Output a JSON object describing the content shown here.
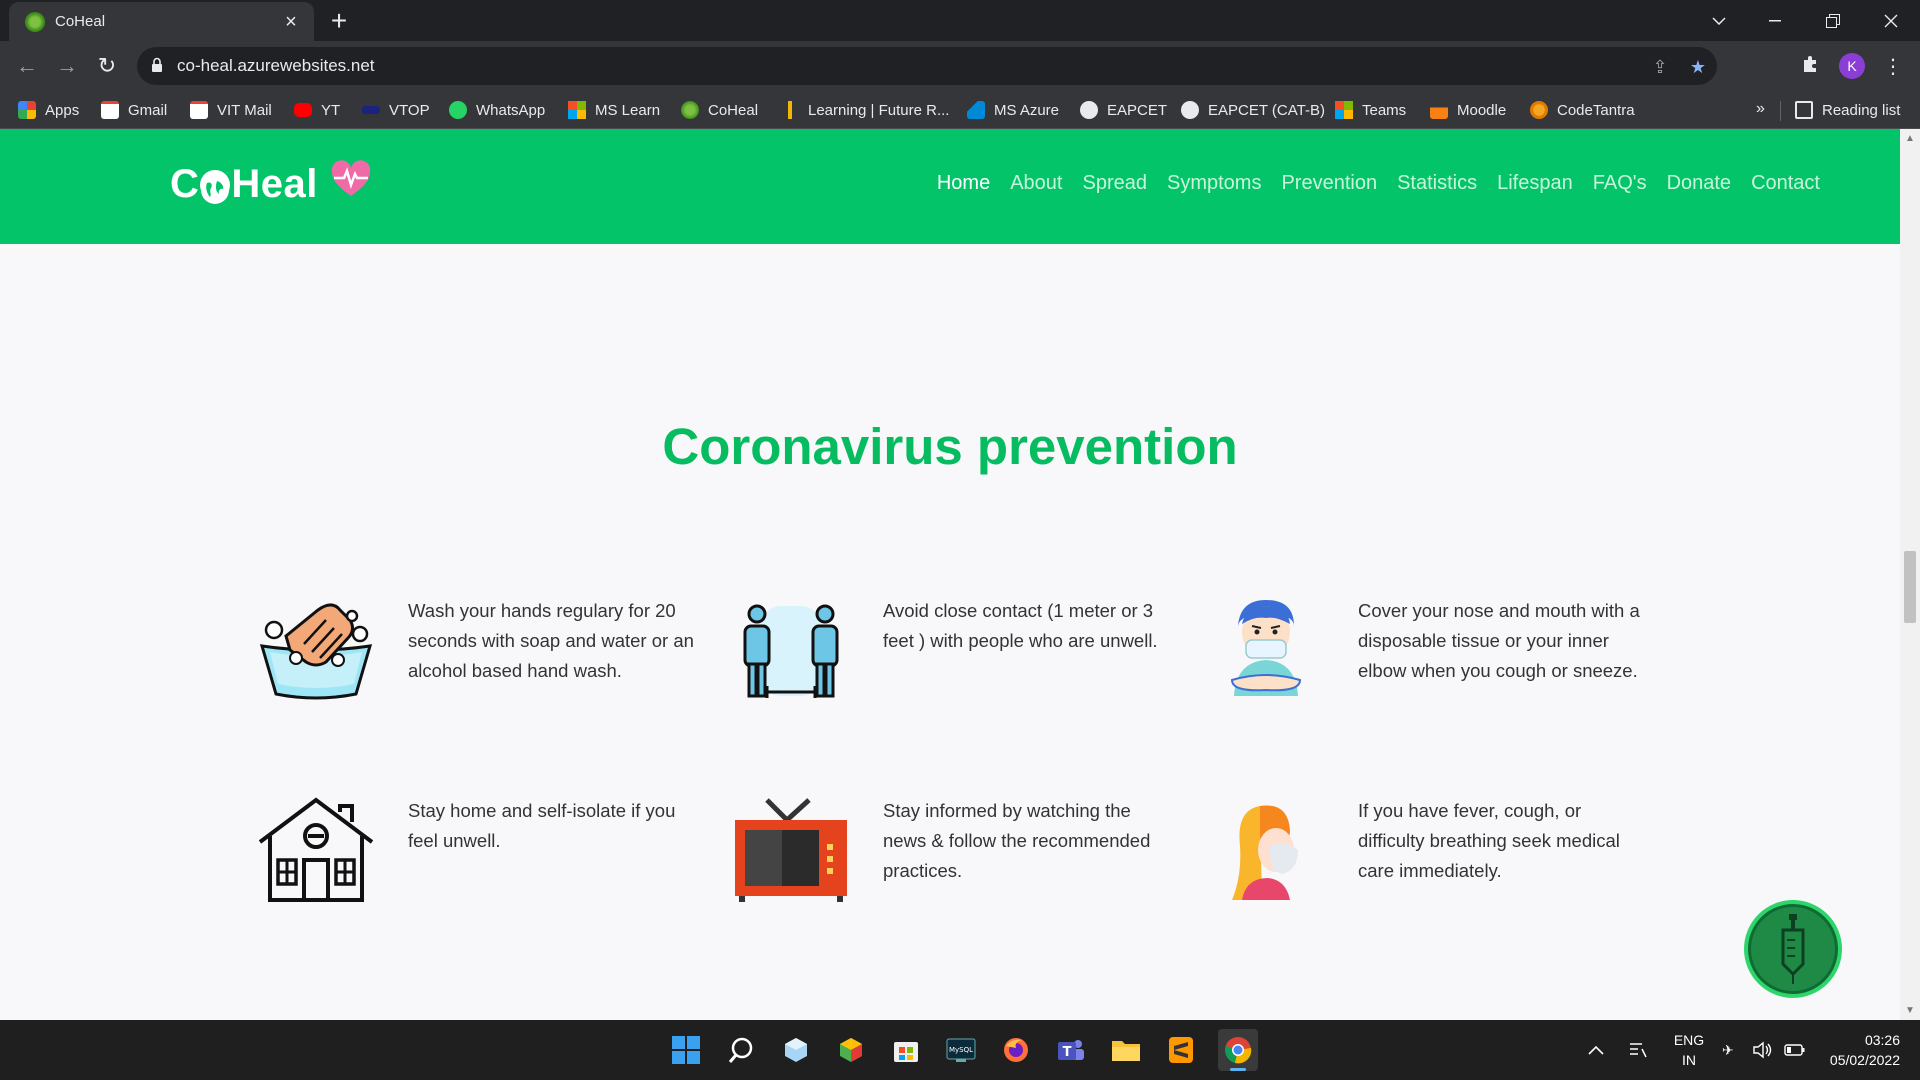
{
  "browser": {
    "tab_title": "CoHeal",
    "url": "co-heal.azurewebsites.net",
    "profile_initial": "K",
    "bookmarks": [
      {
        "label": "Apps",
        "icon": "apps-grid-icon",
        "color": "#4285f4"
      },
      {
        "label": "Gmail",
        "icon": "gmail-icon",
        "color": "#ea4335"
      },
      {
        "label": "VIT Mail",
        "icon": "gmail-icon",
        "color": "#ea4335"
      },
      {
        "label": "YT",
        "icon": "youtube-icon",
        "color": "#ff0000"
      },
      {
        "label": "VTOP",
        "icon": "vtop-icon",
        "color": "#1a237e"
      },
      {
        "label": "WhatsApp",
        "icon": "whatsapp-icon",
        "color": "#25d366"
      },
      {
        "label": "MS Learn",
        "icon": "microsoft-icon",
        "color": "#f25022"
      },
      {
        "label": "CoHeal",
        "icon": "coheal-icon",
        "color": "#5a9e25"
      },
      {
        "label": "Learning | Future R...",
        "icon": "futurer-icon",
        "color": "#f2b705"
      },
      {
        "label": "MS Azure",
        "icon": "azure-icon",
        "color": "#0089d6"
      },
      {
        "label": "EAPCET",
        "icon": "globe-icon",
        "color": "#e8eaed"
      },
      {
        "label": "EAPCET (CAT-B)",
        "icon": "globe-icon",
        "color": "#e8eaed"
      },
      {
        "label": "Teams",
        "icon": "microsoft-icon",
        "color": "#f25022"
      },
      {
        "label": "Moodle",
        "icon": "moodle-icon",
        "color": "#f98012"
      },
      {
        "label": "CodeTantra",
        "icon": "codetantra-icon",
        "color": "#f5a623"
      }
    ],
    "more_bookmarks": "»",
    "reading_list": "Reading list"
  },
  "site": {
    "logo_left": "C",
    "logo_right": "Heal",
    "nav": [
      {
        "label": "Home",
        "active": true
      },
      {
        "label": "About"
      },
      {
        "label": "Spread"
      },
      {
        "label": "Symptoms"
      },
      {
        "label": "Prevention"
      },
      {
        "label": "Statistics"
      },
      {
        "label": "Lifespan"
      },
      {
        "label": "FAQ's"
      },
      {
        "label": "Donate"
      },
      {
        "label": "Contact"
      }
    ],
    "brand_color": "#04c46a",
    "title_color": "#06bb60"
  },
  "prevention": {
    "title": "Coronavirus prevention",
    "items": [
      {
        "icon": "handwash-icon",
        "text": "Wash your hands regulary for 20 seconds with soap and water or an alcohol based hand wash."
      },
      {
        "icon": "social-distance-icon",
        "text": "Avoid close contact (1 meter or 3 feet ) with people who are unwell."
      },
      {
        "icon": "cough-mask-icon",
        "text": "Cover your nose and mouth with a disposable tissue or your inner elbow when you cough or sneeze."
      },
      {
        "icon": "house-icon",
        "text": "Stay home and self-isolate if you feel unwell."
      },
      {
        "icon": "television-icon",
        "text": "Stay informed by watching the news & follow the recommended practices."
      },
      {
        "icon": "fever-person-icon",
        "text": "If you have fever, cough, or difficulty breathing seek medical care immediately."
      }
    ]
  },
  "taskbar": {
    "language_top": "ENG",
    "language_bottom": "IN",
    "time": "03:26",
    "date": "05/02/2022"
  }
}
